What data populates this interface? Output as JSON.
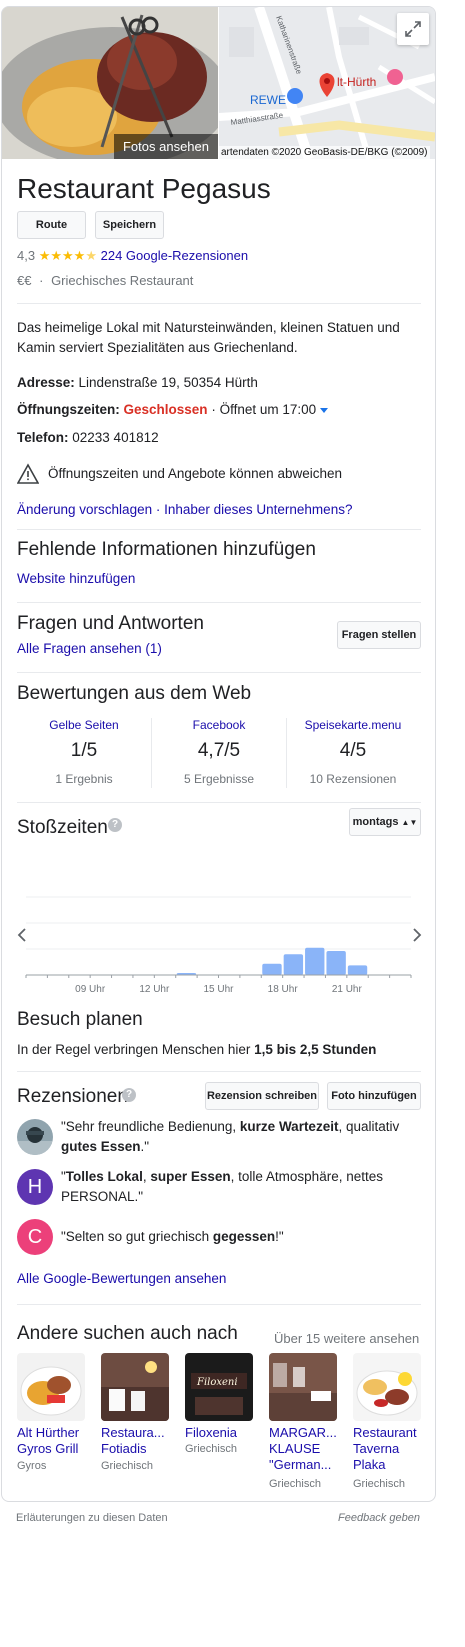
{
  "hero": {
    "photos_label": "Fotos ansehen",
    "map_attribution": "artendaten ©2020 GeoBasis-DE/BKG (©2009)",
    "map_labels": {
      "street1": "Katharinenstraße",
      "street2": "Matthiasstraße",
      "shop": "REWE",
      "place": "lt-Hürth"
    }
  },
  "title": "Restaurant Pegasus",
  "actions": {
    "route": "Route",
    "save": "Speichern"
  },
  "rating": {
    "value": "4,3",
    "stars": 4.3,
    "reviews_link": "224 Google-Rezensionen"
  },
  "meta": {
    "price": "€€",
    "separator": "·",
    "category": "Griechisches Restaurant"
  },
  "description": "Das heimelige Lokal mit Natursteinwänden, kleinen Statuen und Kamin serviert Spezialitäten aus Griechenland.",
  "info": {
    "address_label": "Adresse:",
    "address": "Lindenstraße 19, 50354 Hürth",
    "hours_label": "Öffnungszeiten:",
    "hours_status": "Geschlossen",
    "hours_next": "· Öffnet um 17:00",
    "phone_label": "Telefon:",
    "phone": "02233 401812"
  },
  "warning": "Öffnungszeiten und Angebote können abweichen",
  "suggest_link": "Änderung vorschlagen · Inhaber dieses Unternehmens?",
  "missing": {
    "title": "Fehlende Informationen hinzufügen",
    "link": "Website hinzufügen"
  },
  "qa": {
    "title": "Fragen und Antworten",
    "link": "Alle Fragen ansehen (1)",
    "button": "Fragen stellen"
  },
  "web_ratings": {
    "title": "Bewertungen aus dem Web",
    "items": [
      {
        "source": "Gelbe Seiten",
        "rating": "1/5",
        "count": "1 Ergebnis"
      },
      {
        "source": "Facebook",
        "rating": "4,7/5",
        "count": "5 Ergebnisse"
      },
      {
        "source": "Speisekarte.menu",
        "rating": "4/5",
        "count": "10 Rezensionen"
      }
    ]
  },
  "popular_times": {
    "title": "Stoßzeiten",
    "day_button": "montags",
    "ticks": [
      "09 Uhr",
      "12 Uhr",
      "15 Uhr",
      "18 Uhr",
      "21 Uhr"
    ],
    "bars": [
      0,
      0,
      0,
      0,
      0,
      0,
      0,
      0.03,
      0,
      0,
      0,
      0.35,
      0.65,
      0.85,
      0.75,
      0.3,
      0,
      0
    ]
  },
  "visit": {
    "title": "Besuch planen",
    "text_prefix": "In der Regel verbringen Menschen hier ",
    "text_bold": "1,5 bis 2,5 Stunden"
  },
  "reviews": {
    "title": "Rezensionen",
    "write_button": "Rezension schreiben",
    "photo_button": "Foto hinzufügen",
    "items": [
      {
        "initial": "",
        "color": "#9aa0a6",
        "p1": "\"Sehr freundliche Bedienung, ",
        "b1": "kurze Wartezeit",
        "p2": ", qualitativ ",
        "b2": "gutes Essen",
        "p3": ".\""
      },
      {
        "initial": "H",
        "color": "#5e35b1",
        "p1": "\"",
        "b1": "Tolles Lokal",
        "p2": ", ",
        "b2": "super Essen",
        "p3": ", tolle Atmosphäre, nettes PERSONAL.\""
      },
      {
        "initial": "C",
        "color": "#ec407a",
        "p1": "\"Selten so gut griechisch ",
        "b1": "gegessen",
        "p2": "!\"",
        "b2": "",
        "p3": ""
      }
    ],
    "all_link": "Alle Google-Bewertungen ansehen"
  },
  "others": {
    "title": "Andere suchen auch nach",
    "more_link": "Über 15 weitere ansehen",
    "items": [
      {
        "name": "Alt Hürther Gyros Grill",
        "cat": "Gyros"
      },
      {
        "name": "Restaura... Fotiadis",
        "cat": "Griechisch"
      },
      {
        "name": "Filoxenia",
        "cat": "Griechisch"
      },
      {
        "name": "MARGAR... KLAUSE \"German...",
        "cat": "Griechisch"
      },
      {
        "name": "Restaurant Taverna Plaka",
        "cat": "Griechisch"
      }
    ]
  },
  "footer": {
    "left": "Erläuterungen zu diesen Daten",
    "right": "Feedback geben"
  }
}
